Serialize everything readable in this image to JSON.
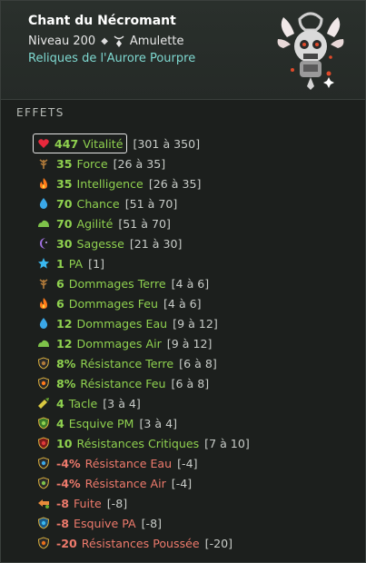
{
  "item": {
    "name": "Chant du Nécromant",
    "level": "Niveau 200",
    "type": "Amulette",
    "set": "Reliques de l'Aurore Pourpre"
  },
  "section_title": "EFFETS",
  "effects": [
    {
      "value": "447",
      "name": "Vitalité",
      "range": "[301 à 350]",
      "icon": "heart-icon",
      "tone": "pos"
    },
    {
      "value": "35",
      "name": "Force",
      "range": "[26 à 35]",
      "icon": "earth-icon",
      "tone": "pos"
    },
    {
      "value": "35",
      "name": "Intelligence",
      "range": "[26 à 35]",
      "icon": "fire-icon",
      "tone": "pos"
    },
    {
      "value": "70",
      "name": "Chance",
      "range": "[51 à 70]",
      "icon": "water-drop-icon",
      "tone": "pos"
    },
    {
      "value": "70",
      "name": "Agilité",
      "range": "[51 à 70]",
      "icon": "air-icon",
      "tone": "pos"
    },
    {
      "value": "30",
      "name": "Sagesse",
      "range": "[21 à 30]",
      "icon": "wisdom-moon-icon",
      "tone": "pos"
    },
    {
      "value": "1",
      "name": "PA",
      "range": "[1]",
      "icon": "star-icon",
      "tone": "pos"
    },
    {
      "value": "6",
      "name": "Dommages Terre",
      "range": "[4 à 6]",
      "icon": "earth-icon",
      "tone": "pos"
    },
    {
      "value": "6",
      "name": "Dommages Feu",
      "range": "[4 à 6]",
      "icon": "fire-icon",
      "tone": "pos"
    },
    {
      "value": "12",
      "name": "Dommages Eau",
      "range": "[9 à 12]",
      "icon": "water-drop-icon",
      "tone": "pos"
    },
    {
      "value": "12",
      "name": "Dommages Air",
      "range": "[9 à 12]",
      "icon": "air-icon",
      "tone": "pos"
    },
    {
      "value": "8%",
      "name": "Résistance Terre",
      "range": "[6 à 8]",
      "icon": "shield-earth-icon",
      "tone": "pos"
    },
    {
      "value": "8%",
      "name": "Résistance Feu",
      "range": "[6 à 8]",
      "icon": "shield-fire-icon",
      "tone": "pos"
    },
    {
      "value": "4",
      "name": "Tacle",
      "range": "[3 à 4]",
      "icon": "tackle-icon",
      "tone": "pos"
    },
    {
      "value": "4",
      "name": "Esquive PM",
      "range": "[3 à 4]",
      "icon": "shield-green-icon",
      "tone": "pos"
    },
    {
      "value": "10",
      "name": "Résistances Critiques",
      "range": "[7 à 10]",
      "icon": "shield-red-icon",
      "tone": "pos"
    },
    {
      "value": "-4%",
      "name": "Résistance Eau",
      "range": "[-4]",
      "icon": "shield-water-icon",
      "tone": "neg"
    },
    {
      "value": "-4%",
      "name": "Résistance Air",
      "range": "[-4]",
      "icon": "shield-air-icon",
      "tone": "neg"
    },
    {
      "value": "-8",
      "name": "Fuite",
      "range": "[-8]",
      "icon": "flee-icon",
      "tone": "neg"
    },
    {
      "value": "-8",
      "name": "Esquive PA",
      "range": "[-8]",
      "icon": "shield-blue-icon",
      "tone": "neg"
    },
    {
      "value": "-20",
      "name": "Résistances Poussée",
      "range": "[-20]",
      "icon": "shield-push-icon",
      "tone": "neg"
    }
  ],
  "colors": {
    "positive": "#8fd14f",
    "negative": "#ee7a6c",
    "set_name": "#7ed8d0",
    "range": "#c8ccc8"
  }
}
